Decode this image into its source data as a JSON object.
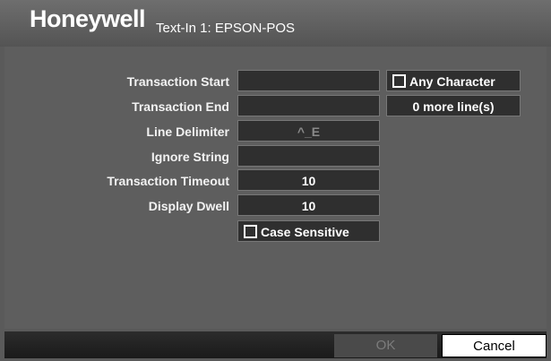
{
  "header": {
    "logo": "Honeywell",
    "title": "Text-In 1: EPSON-POS"
  },
  "form": {
    "transaction_start": {
      "label": "Transaction Start",
      "value": ""
    },
    "transaction_end": {
      "label": "Transaction End",
      "value": ""
    },
    "line_delimiter": {
      "label": "Line Delimiter",
      "value": "^_E"
    },
    "ignore_string": {
      "label": "Ignore String",
      "value": ""
    },
    "transaction_timeout": {
      "label": "Transaction Timeout",
      "value": "10"
    },
    "display_dwell": {
      "label": "Display Dwell",
      "value": "10"
    },
    "any_character": {
      "label": "Any Character",
      "checked": false
    },
    "more_lines": "0 more line(s)",
    "case_sensitive": {
      "label": "Case Sensitive",
      "checked": false
    }
  },
  "footer": {
    "ok_label": "OK",
    "cancel_label": "Cancel"
  }
}
